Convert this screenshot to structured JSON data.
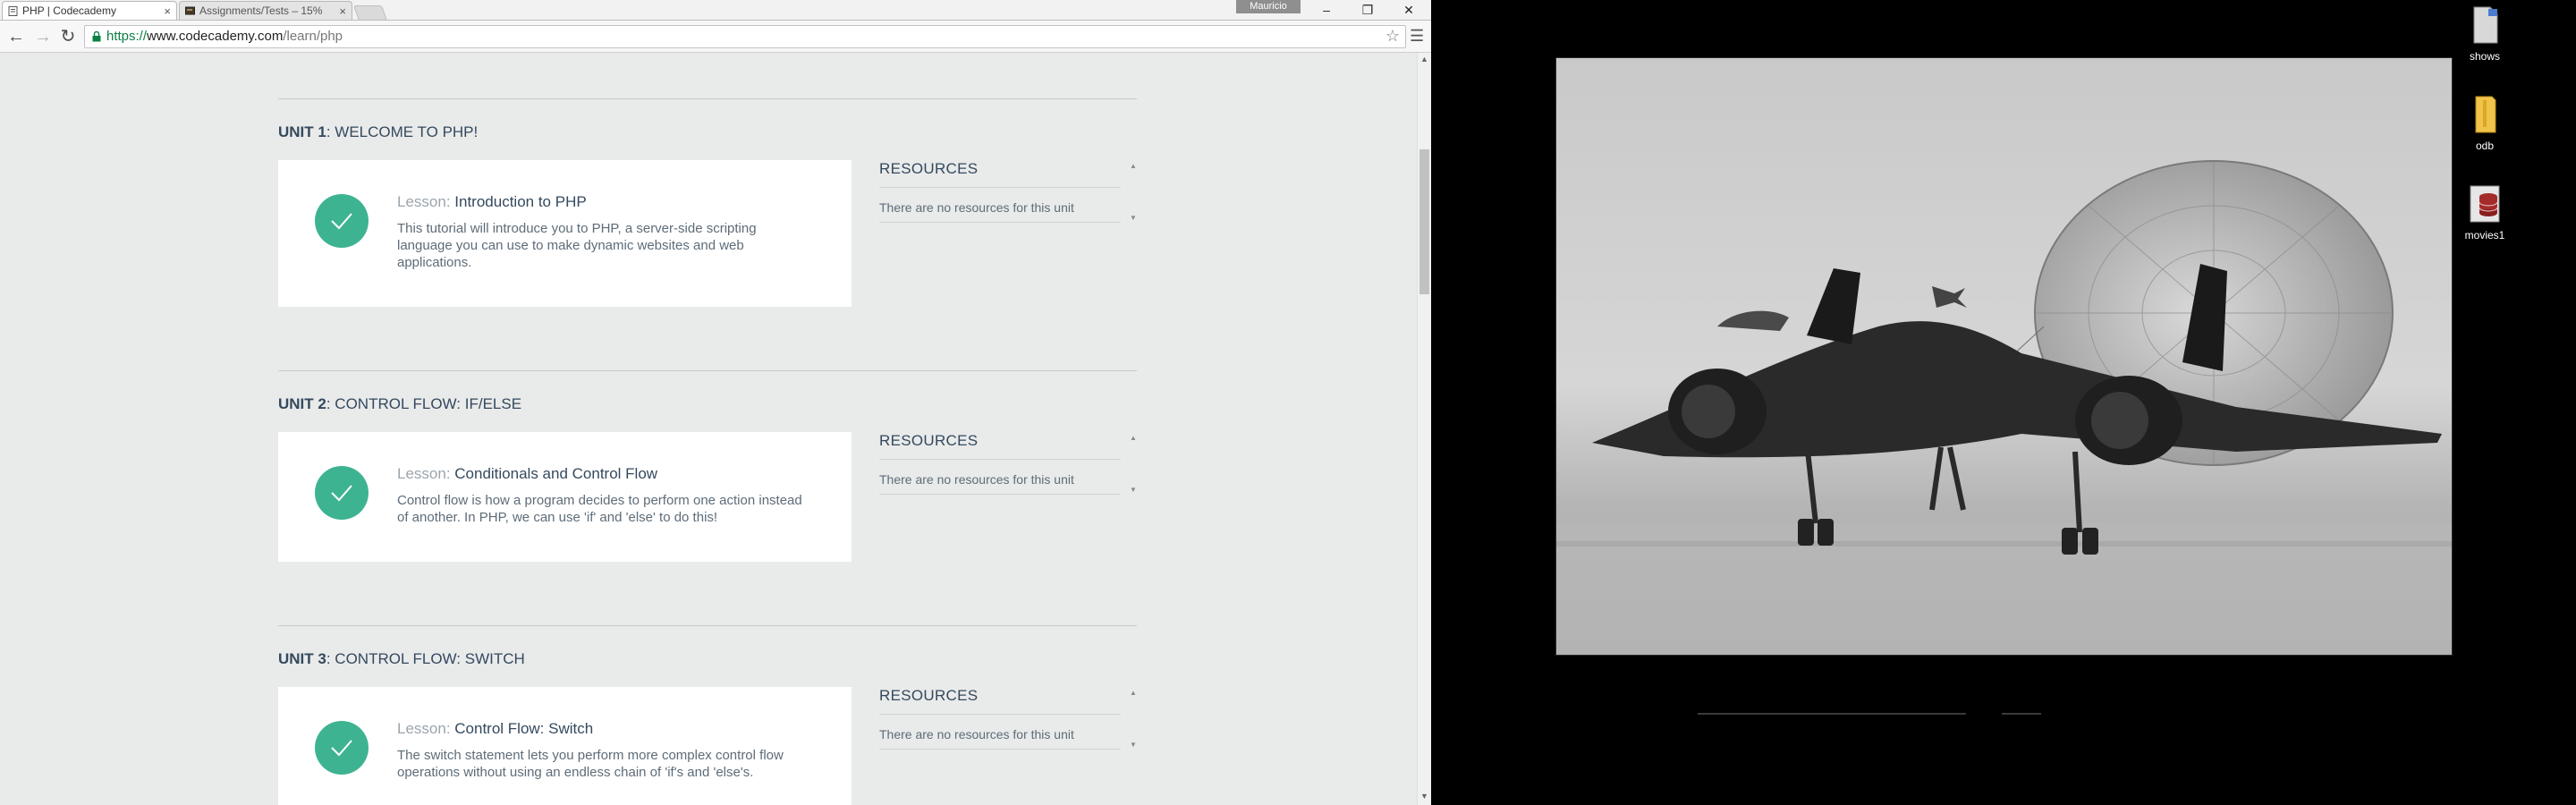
{
  "browser": {
    "tabs": [
      {
        "title": "PHP | Codecademy",
        "active": true
      },
      {
        "title": "Assignments/Tests – 15%",
        "active": false
      }
    ],
    "profile_name": "Mauricio",
    "window_controls": {
      "minimize": "–",
      "maximize": "❐",
      "close": "✕"
    },
    "nav": {
      "back": "←",
      "forward": "→",
      "reload": "↻",
      "menu": "☰",
      "bookmark": "☆"
    },
    "address": {
      "scheme": "https://",
      "host": "www.codecademy.com",
      "path": "/learn/php"
    }
  },
  "course": {
    "units": [
      {
        "number": "UNIT 1",
        "title": ": WELCOME TO PHP!",
        "lesson_prefix": "Lesson: ",
        "lesson_title": "Introduction to PHP",
        "description": "This tutorial will introduce you to PHP, a server-side scripting language you can use to make dynamic websites and web applications.",
        "completed": true,
        "resources_heading": "RESOURCES",
        "resources_text": "There are no resources for this unit"
      },
      {
        "number": "UNIT 2",
        "title": ": CONTROL FLOW: IF/ELSE",
        "lesson_prefix": "Lesson: ",
        "lesson_title": "Conditionals and Control Flow",
        "description": "Control flow is how a program decides to perform one action instead of another. In PHP, we can use 'if' and 'else' to do this!",
        "completed": true,
        "resources_heading": "RESOURCES",
        "resources_text": "There are no resources for this unit"
      },
      {
        "number": "UNIT 3",
        "title": ": CONTROL FLOW: SWITCH",
        "lesson_prefix": "Lesson: ",
        "lesson_title": "Control Flow: Switch",
        "description": "The switch statement lets you perform more complex control flow operations without using an endless chain of 'if's and 'else's.",
        "completed": true,
        "resources_heading": "RESOURCES",
        "resources_text": "There are no resources for this unit"
      }
    ]
  },
  "desktop": {
    "icons": [
      {
        "label": "shows",
        "icon": "file-icon"
      },
      {
        "label": "odb",
        "icon": "folder-icon"
      },
      {
        "label": "movies1",
        "icon": "database-icon"
      }
    ],
    "photo": {
      "subject": "sr71-blackbird-photo"
    }
  },
  "colors": {
    "check_green": "#3eb392",
    "page_bg": "#e9eaea",
    "heading": "#34495e",
    "url_green": "#0b8043"
  }
}
